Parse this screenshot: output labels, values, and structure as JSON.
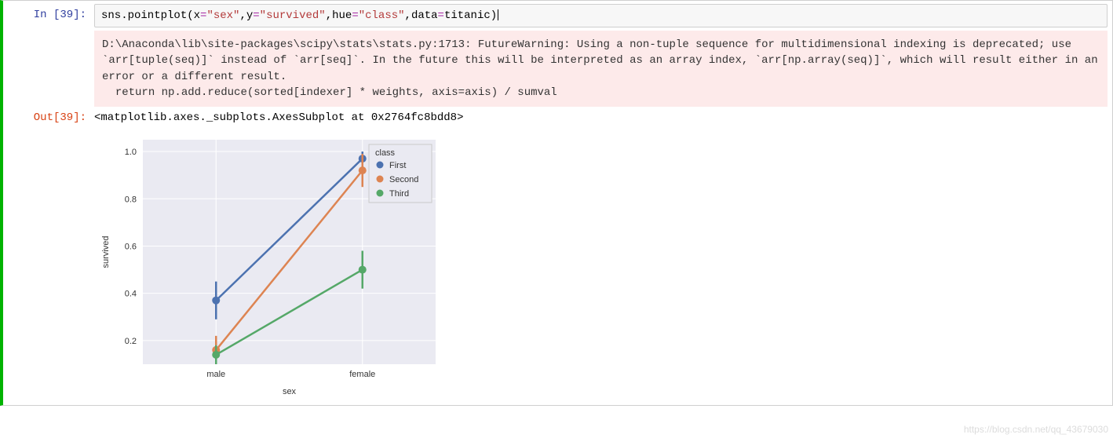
{
  "input_prompt": "In  [39]:",
  "output_prompt": "Out[39]:",
  "code_tokens": {
    "t1": "sns.pointplot",
    "t2": "(",
    "t3": "x",
    "t4": "=",
    "t5": "\"sex\"",
    "t6": ",",
    "t7": "y",
    "t8": "=",
    "t9": "\"survived\"",
    "t10": ",",
    "t11": "hue",
    "t12": "=",
    "t13": "\"class\"",
    "t14": ",",
    "t15": "data",
    "t16": "=",
    "t17": "titanic",
    "t18": ")"
  },
  "warning_text": "D:\\Anaconda\\lib\\site-packages\\scipy\\stats\\stats.py:1713: FutureWarning: Using a non-tuple sequence for multidimensional indexing is deprecated; use `arr[tuple(seq)]` instead of `arr[seq]`. In the future this will be interpreted as an array index, `arr[np.array(seq)]`, which will result either in an error or a different result.\n  return np.add.reduce(sorted[indexer] * weights, axis=axis) / sumval",
  "output_text": "<matplotlib.axes._subplots.AxesSubplot at 0x2764fc8bdd8>",
  "watermark": "https://blog.csdn.net/qq_43679030",
  "chart_data": {
    "type": "pointplot",
    "xlabel": "sex",
    "ylabel": "survived",
    "categories": [
      "male",
      "female"
    ],
    "y_ticks": [
      0.2,
      0.4,
      0.6,
      0.8,
      1.0
    ],
    "ylim": [
      0.1,
      1.05
    ],
    "legend_title": "class",
    "series": [
      {
        "name": "First",
        "color": "#4c72b0",
        "values": [
          0.37,
          0.97
        ],
        "ci_low": [
          0.29,
          0.93
        ],
        "ci_high": [
          0.45,
          1.0
        ]
      },
      {
        "name": "Second",
        "color": "#dd8452",
        "values": [
          0.16,
          0.92
        ],
        "ci_low": [
          0.1,
          0.85
        ],
        "ci_high": [
          0.22,
          0.99
        ]
      },
      {
        "name": "Third",
        "color": "#55a868",
        "values": [
          0.14,
          0.5
        ],
        "ci_low": [
          0.1,
          0.42
        ],
        "ci_high": [
          0.18,
          0.58
        ]
      }
    ]
  }
}
